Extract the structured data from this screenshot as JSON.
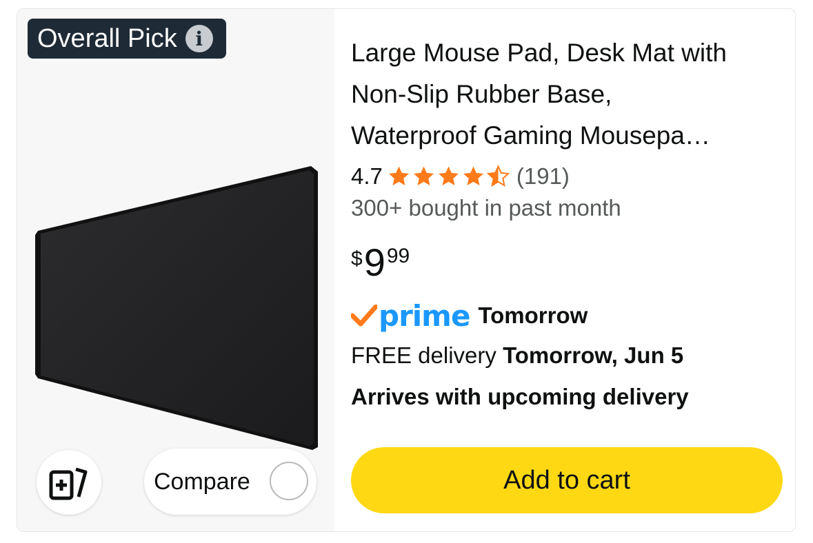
{
  "badge": {
    "label": "Overall Pick",
    "info_icon": "info-icon"
  },
  "product": {
    "image_icon": "black-mouse-pad-image",
    "title_line1": "Large Mouse Pad, Desk Mat with",
    "title_line2": "Non-Slip Rubber Base,",
    "title_line3": "Waterproof Gaming Mousepa…",
    "rating": "4.7",
    "rating_value": 4.7,
    "rating_max": 5,
    "review_count": "(191)",
    "bought_text": "300+ bought in past month",
    "price_symbol": "$",
    "price_whole": "9",
    "price_fraction": "99"
  },
  "delivery": {
    "prime_logo_text": "prime",
    "prime_day": "Tomorrow",
    "free_label": "FREE delivery",
    "free_date": "Tomorrow, Jun 5",
    "arrives_text": "Arrives with upcoming delivery"
  },
  "actions": {
    "compare_label": "Compare",
    "add_to_cart_label": "Add to cart",
    "similar_icon": "add-to-list-icon"
  },
  "colors": {
    "badge_bg": "#1e2a36",
    "star": "#ff7b1a",
    "prime_blue": "#1a98ff",
    "prime_check": "#ff7b1a",
    "cart_button": "#ffd814"
  }
}
